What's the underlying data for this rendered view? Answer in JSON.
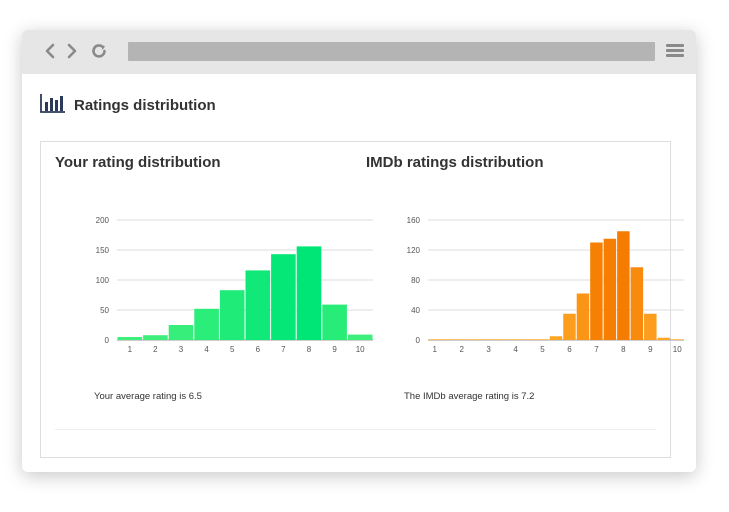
{
  "page": {
    "title": "Ratings distribution"
  },
  "panels": {
    "yours": {
      "title": "Your rating distribution",
      "average_text": "Your average rating is 6.5"
    },
    "imdb": {
      "title": "IMDb ratings distribution",
      "average_text": "The IMDb average rating is 7.2"
    }
  },
  "icons": {
    "back": "chevron-left-icon",
    "forward": "chevron-right-icon",
    "reload": "reload-icon",
    "menu": "hamburger-menu-icon",
    "chart": "bar-chart-icon"
  },
  "chart_data": [
    {
      "type": "bar",
      "title": "",
      "xlabel": "",
      "ylabel": "",
      "categories": [
        "1",
        "2",
        "3",
        "4",
        "5",
        "6",
        "7",
        "8",
        "9",
        "10"
      ],
      "values": [
        5,
        8,
        25,
        52,
        83,
        116,
        143,
        156,
        59,
        9
      ],
      "yticks": [
        0,
        50,
        100,
        150,
        200
      ],
      "ylim": [
        0,
        200
      ],
      "grid": true,
      "color_range": [
        "#40f07a",
        "#00e676"
      ]
    },
    {
      "type": "bar",
      "title": "",
      "xlabel": "",
      "ylabel": "",
      "x": [
        1,
        1.5,
        2,
        2.5,
        3,
        3.5,
        4,
        4.5,
        5,
        5.5,
        6,
        6.5,
        7,
        7.5,
        8,
        8.5,
        9,
        9.5,
        10
      ],
      "values": [
        1,
        1,
        1,
        1,
        1,
        1,
        1,
        1,
        1,
        5,
        35,
        62,
        130,
        135,
        145,
        97,
        35,
        3,
        1
      ],
      "xticks": [
        "1",
        "2",
        "3",
        "4",
        "5",
        "6",
        "7",
        "8",
        "9",
        "10"
      ],
      "yticks": [
        0,
        40,
        80,
        120,
        160
      ],
      "ylim": [
        0,
        160
      ],
      "grid": true,
      "color_range": [
        "#ffa726",
        "#f57c00"
      ]
    }
  ]
}
